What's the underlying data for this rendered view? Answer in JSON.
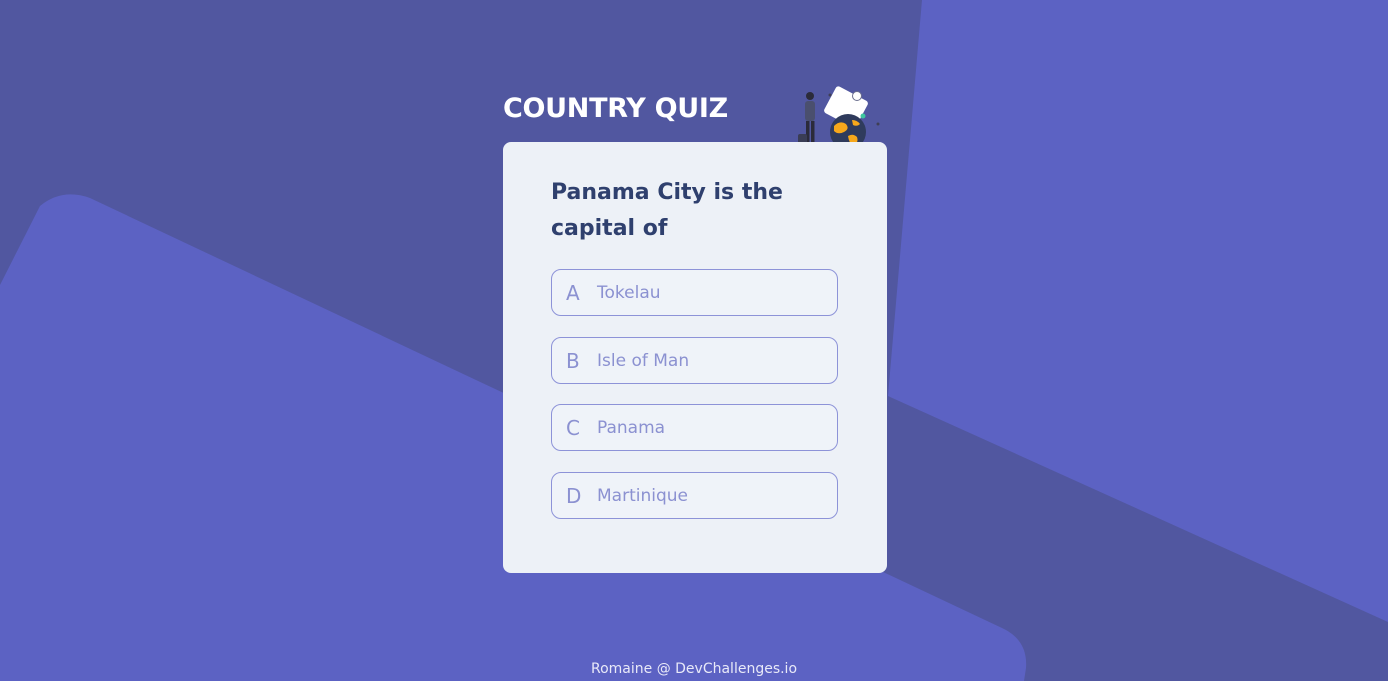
{
  "app": {
    "title": "COUNTRY QUIZ"
  },
  "quiz": {
    "question": "Panama City is the capital of",
    "options": [
      {
        "letter": "A",
        "text": "Tokelau"
      },
      {
        "letter": "B",
        "text": "Isle of Man"
      },
      {
        "letter": "C",
        "text": "Panama"
      },
      {
        "letter": "D",
        "text": "Martinique"
      }
    ]
  },
  "footer": {
    "credit": "Romaine @ DevChallenges.io"
  },
  "colors": {
    "background": "#5157a0",
    "shape": "#5c62c3",
    "card": "#edf1f7",
    "question": "#2f406e",
    "option_border": "#8d93d8",
    "option_text": "#8b91d1"
  },
  "icons": {
    "illustration": "traveler-with-globe-illustration"
  }
}
